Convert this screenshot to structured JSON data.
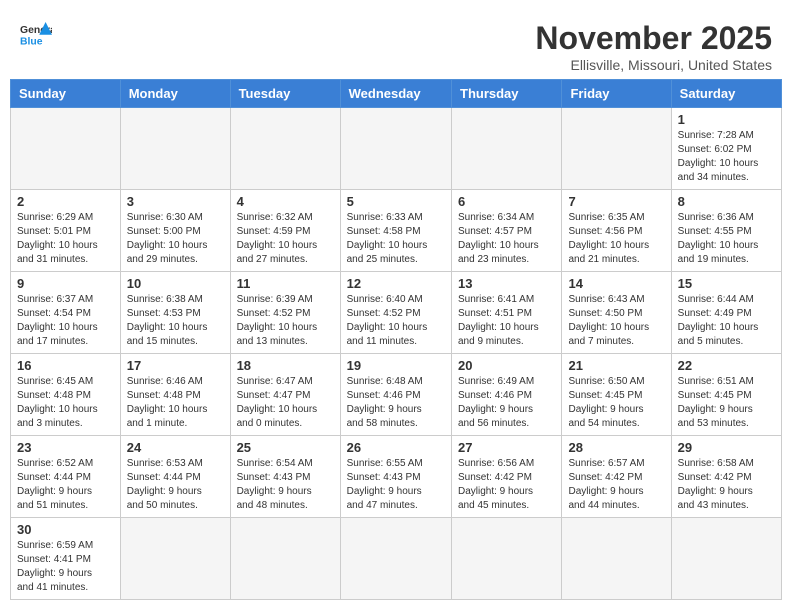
{
  "header": {
    "logo_general": "General",
    "logo_blue": "Blue",
    "month": "November 2025",
    "location": "Ellisville, Missouri, United States"
  },
  "weekdays": [
    "Sunday",
    "Monday",
    "Tuesday",
    "Wednesday",
    "Thursday",
    "Friday",
    "Saturday"
  ],
  "weeks": [
    [
      {
        "day": "",
        "info": ""
      },
      {
        "day": "",
        "info": ""
      },
      {
        "day": "",
        "info": ""
      },
      {
        "day": "",
        "info": ""
      },
      {
        "day": "",
        "info": ""
      },
      {
        "day": "",
        "info": ""
      },
      {
        "day": "1",
        "info": "Sunrise: 7:28 AM\nSunset: 6:02 PM\nDaylight: 10 hours\nand 34 minutes."
      }
    ],
    [
      {
        "day": "2",
        "info": "Sunrise: 6:29 AM\nSunset: 5:01 PM\nDaylight: 10 hours\nand 31 minutes."
      },
      {
        "day": "3",
        "info": "Sunrise: 6:30 AM\nSunset: 5:00 PM\nDaylight: 10 hours\nand 29 minutes."
      },
      {
        "day": "4",
        "info": "Sunrise: 6:32 AM\nSunset: 4:59 PM\nDaylight: 10 hours\nand 27 minutes."
      },
      {
        "day": "5",
        "info": "Sunrise: 6:33 AM\nSunset: 4:58 PM\nDaylight: 10 hours\nand 25 minutes."
      },
      {
        "day": "6",
        "info": "Sunrise: 6:34 AM\nSunset: 4:57 PM\nDaylight: 10 hours\nand 23 minutes."
      },
      {
        "day": "7",
        "info": "Sunrise: 6:35 AM\nSunset: 4:56 PM\nDaylight: 10 hours\nand 21 minutes."
      },
      {
        "day": "8",
        "info": "Sunrise: 6:36 AM\nSunset: 4:55 PM\nDaylight: 10 hours\nand 19 minutes."
      }
    ],
    [
      {
        "day": "9",
        "info": "Sunrise: 6:37 AM\nSunset: 4:54 PM\nDaylight: 10 hours\nand 17 minutes."
      },
      {
        "day": "10",
        "info": "Sunrise: 6:38 AM\nSunset: 4:53 PM\nDaylight: 10 hours\nand 15 minutes."
      },
      {
        "day": "11",
        "info": "Sunrise: 6:39 AM\nSunset: 4:52 PM\nDaylight: 10 hours\nand 13 minutes."
      },
      {
        "day": "12",
        "info": "Sunrise: 6:40 AM\nSunset: 4:52 PM\nDaylight: 10 hours\nand 11 minutes."
      },
      {
        "day": "13",
        "info": "Sunrise: 6:41 AM\nSunset: 4:51 PM\nDaylight: 10 hours\nand 9 minutes."
      },
      {
        "day": "14",
        "info": "Sunrise: 6:43 AM\nSunset: 4:50 PM\nDaylight: 10 hours\nand 7 minutes."
      },
      {
        "day": "15",
        "info": "Sunrise: 6:44 AM\nSunset: 4:49 PM\nDaylight: 10 hours\nand 5 minutes."
      }
    ],
    [
      {
        "day": "16",
        "info": "Sunrise: 6:45 AM\nSunset: 4:48 PM\nDaylight: 10 hours\nand 3 minutes."
      },
      {
        "day": "17",
        "info": "Sunrise: 6:46 AM\nSunset: 4:48 PM\nDaylight: 10 hours\nand 1 minute."
      },
      {
        "day": "18",
        "info": "Sunrise: 6:47 AM\nSunset: 4:47 PM\nDaylight: 10 hours\nand 0 minutes."
      },
      {
        "day": "19",
        "info": "Sunrise: 6:48 AM\nSunset: 4:46 PM\nDaylight: 9 hours\nand 58 minutes."
      },
      {
        "day": "20",
        "info": "Sunrise: 6:49 AM\nSunset: 4:46 PM\nDaylight: 9 hours\nand 56 minutes."
      },
      {
        "day": "21",
        "info": "Sunrise: 6:50 AM\nSunset: 4:45 PM\nDaylight: 9 hours\nand 54 minutes."
      },
      {
        "day": "22",
        "info": "Sunrise: 6:51 AM\nSunset: 4:45 PM\nDaylight: 9 hours\nand 53 minutes."
      }
    ],
    [
      {
        "day": "23",
        "info": "Sunrise: 6:52 AM\nSunset: 4:44 PM\nDaylight: 9 hours\nand 51 minutes."
      },
      {
        "day": "24",
        "info": "Sunrise: 6:53 AM\nSunset: 4:44 PM\nDaylight: 9 hours\nand 50 minutes."
      },
      {
        "day": "25",
        "info": "Sunrise: 6:54 AM\nSunset: 4:43 PM\nDaylight: 9 hours\nand 48 minutes."
      },
      {
        "day": "26",
        "info": "Sunrise: 6:55 AM\nSunset: 4:43 PM\nDaylight: 9 hours\nand 47 minutes."
      },
      {
        "day": "27",
        "info": "Sunrise: 6:56 AM\nSunset: 4:42 PM\nDaylight: 9 hours\nand 45 minutes."
      },
      {
        "day": "28",
        "info": "Sunrise: 6:57 AM\nSunset: 4:42 PM\nDaylight: 9 hours\nand 44 minutes."
      },
      {
        "day": "29",
        "info": "Sunrise: 6:58 AM\nSunset: 4:42 PM\nDaylight: 9 hours\nand 43 minutes."
      }
    ],
    [
      {
        "day": "30",
        "info": "Sunrise: 6:59 AM\nSunset: 4:41 PM\nDaylight: 9 hours\nand 41 minutes."
      },
      {
        "day": "",
        "info": ""
      },
      {
        "day": "",
        "info": ""
      },
      {
        "day": "",
        "info": ""
      },
      {
        "day": "",
        "info": ""
      },
      {
        "day": "",
        "info": ""
      },
      {
        "day": "",
        "info": ""
      }
    ]
  ]
}
